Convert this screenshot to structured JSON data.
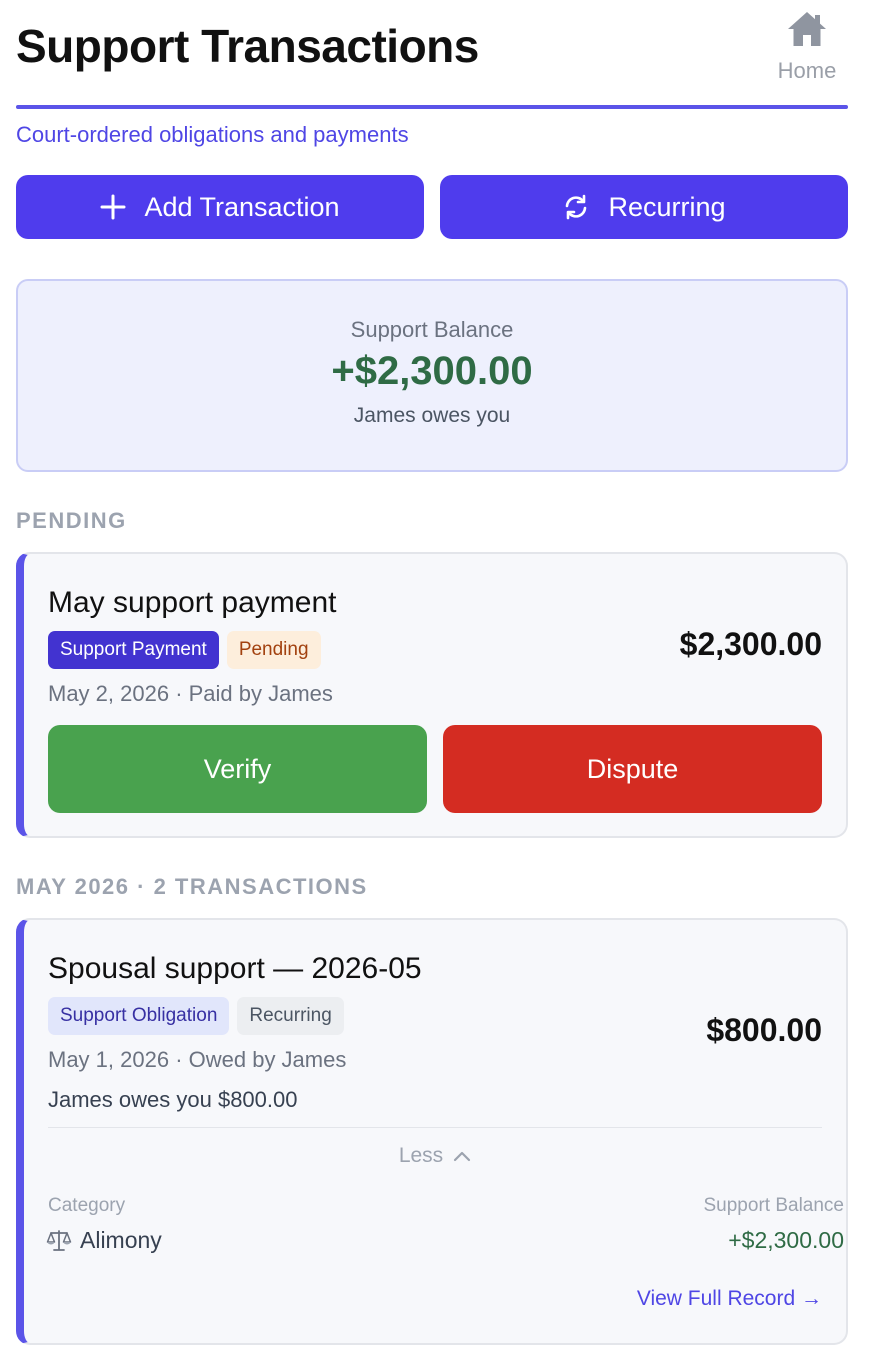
{
  "header": {
    "title": "Support Transactions",
    "home_label": "Home",
    "subtitle": "Court-ordered obligations and payments"
  },
  "actions": {
    "add_label": "Add Transaction",
    "recurring_label": "Recurring"
  },
  "balance": {
    "label": "Support Balance",
    "amount": "+$2,300.00",
    "note": "James owes you"
  },
  "pending": {
    "section_label": "PENDING",
    "title": "May support payment",
    "tags": [
      "Support Payment",
      "Pending"
    ],
    "meta": "May 2, 2026 · Paid by James",
    "amount": "$2,300.00",
    "verify_label": "Verify",
    "dispute_label": "Dispute"
  },
  "month": {
    "section_label": "MAY 2026 · 2 TRANSACTIONS",
    "title": "Spousal support — 2026-05",
    "tags": [
      "Support Obligation",
      "Recurring"
    ],
    "meta": "May 1, 2026 · Owed by James",
    "owes_text": "James owes you $800.00",
    "amount": "$800.00",
    "less_label": "Less",
    "category_label": "Category",
    "category_icon": "scales-icon",
    "category_value": "Alimony",
    "balance_label": "Support Balance",
    "balance_value": "+$2,300.00",
    "view_label": "View Full Record →"
  },
  "colors": {
    "accent": "#4f3ced",
    "positive": "#2f6b45",
    "verify": "#49a24e",
    "dispute": "#d42c22"
  }
}
